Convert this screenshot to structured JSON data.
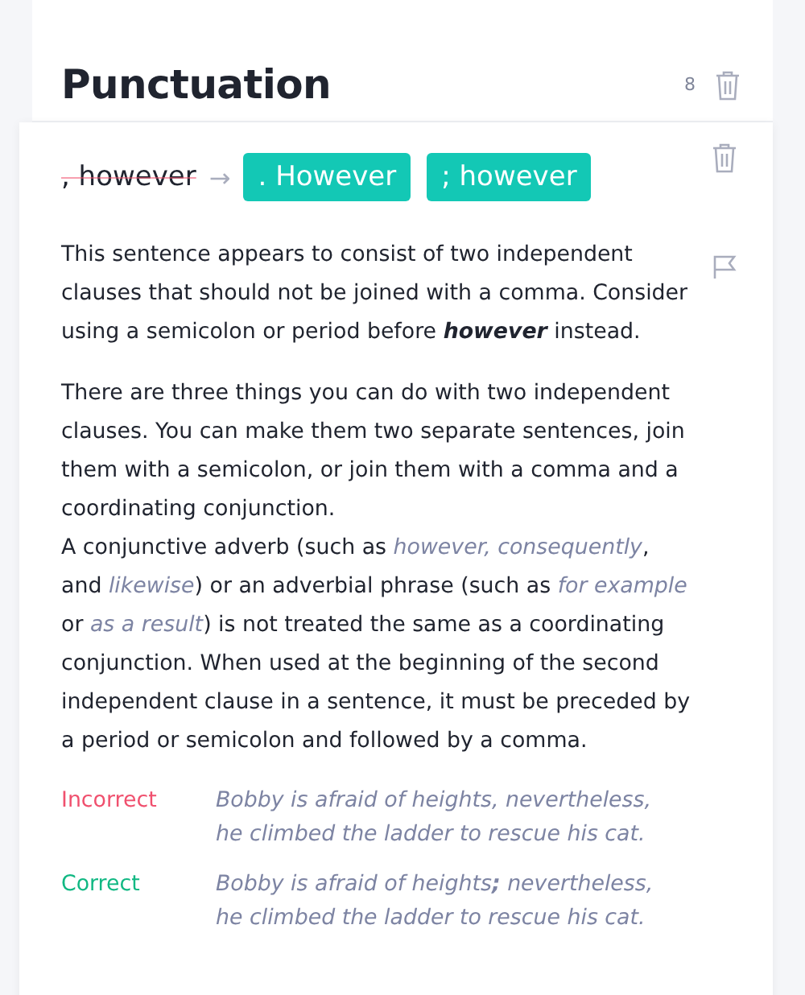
{
  "header": {
    "title": "Punctuation",
    "count": "8"
  },
  "card": {
    "original": ", however",
    "arrow": "→",
    "suggestions": [
      ". However",
      "; however"
    ],
    "explanation_blocks": [
      [
        "This sentence appears to consist of two independent clauses that should not be joined with a comma. Consider using a semicolon or period before **however** instead."
      ],
      [
        "There are three things you can do with two independent clauses. You can make them two separate sentences, join them with a semicolon, or join them with a comma and a coordinating conjunction.",
        "A conjunctive adverb (such as *however, consequently*, and *likewise*) or an adverbial phrase (such as *for example* or *as a result*) is not treated the same as a coordinating conjunction. When used at the beginning of the second independent clause in a sentence, it must be preceded by a period or semicolon and followed by a comma."
      ]
    ],
    "examples": [
      {
        "kind": "incorrect",
        "label": "Incorrect",
        "lines": [
          "Bobby is afraid of heights, nevertheless,",
          "he climbed the ladder to rescue his cat."
        ]
      },
      {
        "kind": "correct",
        "label": "Correct",
        "lines": [
          "Bobby is afraid of heights**;** nevertheless,",
          "he climbed the ladder to rescue his cat."
        ]
      }
    ]
  }
}
